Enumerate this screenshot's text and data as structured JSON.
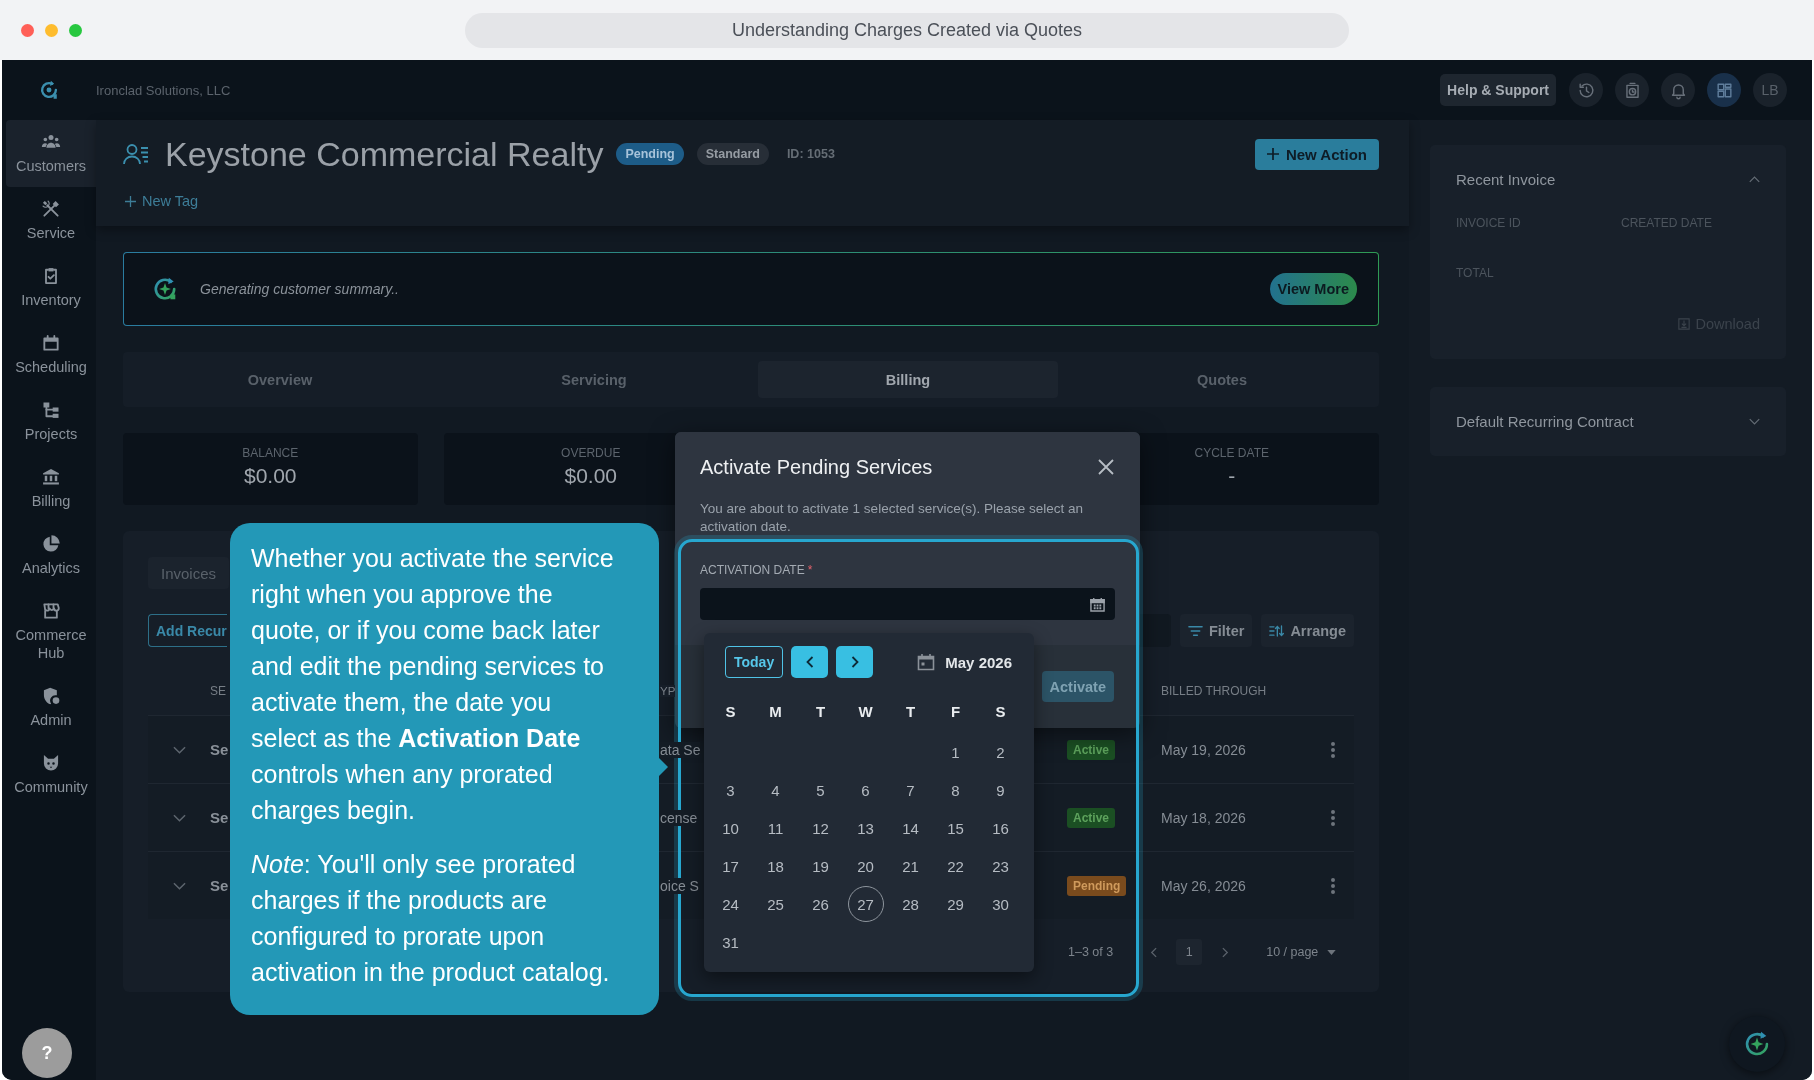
{
  "browser": {
    "title": "Understanding Charges Created via Quotes"
  },
  "topbar": {
    "company": "Ironclad Solutions, LLC",
    "help_button": "Help & Support",
    "avatar": "LB"
  },
  "sidebar": {
    "items": [
      {
        "label": "Customers",
        "selected": true
      },
      {
        "label": "Service",
        "selected": false
      },
      {
        "label": "Inventory",
        "selected": false
      },
      {
        "label": "Scheduling",
        "selected": false
      },
      {
        "label": "Projects",
        "selected": false
      },
      {
        "label": "Billing",
        "selected": false
      },
      {
        "label": "Analytics",
        "selected": false
      },
      {
        "label": "Commerce Hub",
        "selected": false
      },
      {
        "label": "Admin",
        "selected": false
      },
      {
        "label": "Community",
        "selected": false
      }
    ],
    "help": "?"
  },
  "customer": {
    "name": "Keystone Commercial Realty",
    "badges": [
      {
        "label": "Pending",
        "kind": "status"
      },
      {
        "label": "Standard",
        "kind": "tier"
      }
    ],
    "id": "ID: 1053",
    "new_tag": "New Tag",
    "new_action": "New Action"
  },
  "summary": {
    "text": "Generating customer summary..",
    "button": "View More"
  },
  "tabs": [
    {
      "label": "Overview",
      "selected": false
    },
    {
      "label": "Servicing",
      "selected": false
    },
    {
      "label": "Billing",
      "selected": true
    },
    {
      "label": "Quotes",
      "selected": false
    }
  ],
  "stats": [
    {
      "label": "BALANCE",
      "value": "$0.00"
    },
    {
      "label": "OVERDUE",
      "value": "$0.00"
    },
    {
      "label": "CYCLE DATE",
      "value": "-"
    }
  ],
  "billing": {
    "subtabs": [
      {
        "label": "Invoices",
        "selected": false
      }
    ],
    "add_button": "Add Recur",
    "filter": "Filter",
    "arrange": "Arrange",
    "columns": [
      "SE",
      "YP",
      "BILLED THROUGH"
    ],
    "rows": [
      {
        "expanded": false,
        "column_1": "Se",
        "column_2": "ata Se",
        "status": {
          "label": "Active",
          "kind": "active"
        },
        "billed_through": "May 19, 2026"
      },
      {
        "expanded": false,
        "column_1": "Se",
        "column_2": "cense",
        "status": {
          "label": "Active",
          "kind": "active"
        },
        "billed_through": "May 18, 2026"
      },
      {
        "expanded": false,
        "column_1": "Se",
        "column_2": "oice S",
        "status": {
          "label": "Pending",
          "kind": "pending"
        },
        "billed_through": "May 26, 2026"
      }
    ],
    "pagination": {
      "range": "1–3 of 3",
      "page": "1",
      "page_size": "10 / page"
    }
  },
  "modal": {
    "title": "Activate Pending Services",
    "description": "You are about to activate 1 selected service(s). Please select an activation date.",
    "field_label": "ACTIVATION DATE",
    "required_mark": "*",
    "button": "Activate"
  },
  "calendar": {
    "today_button": "Today",
    "month": "May 2026",
    "weekdays": [
      "S",
      "M",
      "T",
      "W",
      "T",
      "F",
      "S"
    ],
    "weeks": [
      [
        {
          "day": "1",
          "today": false
        },
        {
          "day": "2",
          "today": false
        }
      ],
      [
        {
          "day": "3",
          "today": false
        },
        {
          "day": "4",
          "today": false
        },
        {
          "day": "5",
          "today": false
        },
        {
          "day": "6",
          "today": false
        },
        {
          "day": "7",
          "today": false
        },
        {
          "day": "8",
          "today": false
        },
        {
          "day": "9",
          "today": false
        }
      ],
      [
        {
          "day": "10",
          "today": false
        },
        {
          "day": "11",
          "today": false
        },
        {
          "day": "12",
          "today": false
        },
        {
          "day": "13",
          "today": false
        },
        {
          "day": "14",
          "today": false
        },
        {
          "day": "15",
          "today": false
        },
        {
          "day": "16",
          "today": false
        }
      ],
      [
        {
          "day": "17",
          "today": false
        },
        {
          "day": "18",
          "today": false
        },
        {
          "day": "19",
          "today": false
        },
        {
          "day": "20",
          "today": false
        },
        {
          "day": "21",
          "today": false
        },
        {
          "day": "22",
          "today": false
        },
        {
          "day": "23",
          "today": false
        }
      ],
      [
        {
          "day": "24",
          "today": false
        },
        {
          "day": "25",
          "today": false
        },
        {
          "day": "26",
          "today": false
        },
        {
          "day": "27",
          "today": true
        },
        {
          "day": "28",
          "today": false
        },
        {
          "day": "29",
          "today": false
        },
        {
          "day": "30",
          "today": false
        }
      ],
      [
        {
          "day": "31",
          "today": false
        }
      ]
    ]
  },
  "tooltip": {
    "paragraphs": [
      "Whether you activate the service right when you approve the quote, or if you come back later and edit the pending services to activate them, the date you select as the **Activation Date** controls when any prorated charges begin.",
      "*Note*: You'll only see prorated charges if the products are configured to prorate upon activation in the product catalog."
    ]
  },
  "right_panel": {
    "cards": [
      {
        "title": "Recent Invoice",
        "expanded": true,
        "fields": [
          "INVOICE ID",
          "CREATED DATE",
          "TOTAL"
        ],
        "download": "Download"
      },
      {
        "title": "Default Recurring Contract",
        "expanded": false
      }
    ]
  }
}
